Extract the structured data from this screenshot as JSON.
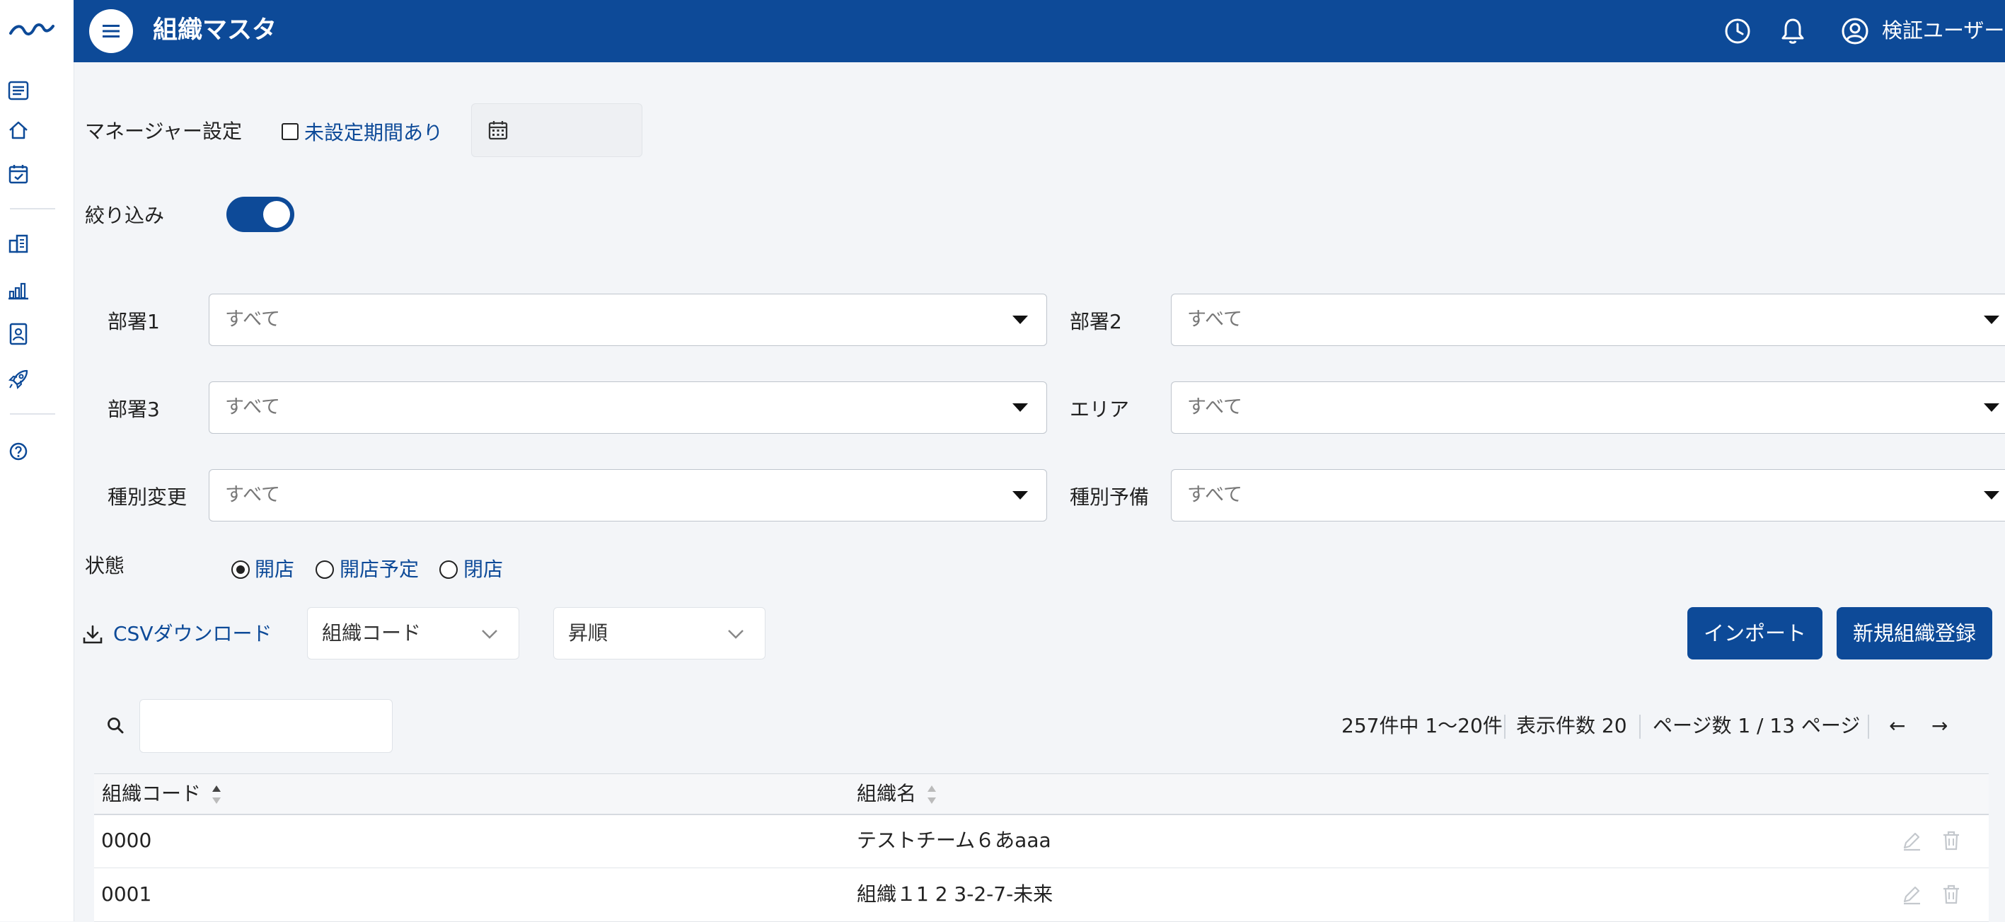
{
  "header": {
    "title": "組織マスタ",
    "user_name": "検証ユーザー"
  },
  "manager": {
    "label": "マネージャー設定",
    "checkbox_label": "未設定期間あり"
  },
  "filter": {
    "toggle_label": "絞り込み",
    "toggle_on": true
  },
  "selects": [
    {
      "label": "部署1",
      "value": "すべて"
    },
    {
      "label": "部署2",
      "value": "すべて"
    },
    {
      "label": "部署3",
      "value": "すべて"
    },
    {
      "label": "エリア",
      "value": "すべて"
    },
    {
      "label": "種別変更",
      "value": "すべて"
    },
    {
      "label": "種別予備",
      "value": "すべて"
    }
  ],
  "status": {
    "label": "状態",
    "options": [
      {
        "label": "開店",
        "selected": true
      },
      {
        "label": "開店予定",
        "selected": false
      },
      {
        "label": "閉店",
        "selected": false
      }
    ]
  },
  "toolbar": {
    "csv_label": "CSVダウンロード",
    "sort_field": "組織コード",
    "sort_order": "昇順",
    "import_label": "インポート",
    "new_label": "新規組織登録"
  },
  "pagination": {
    "summary": "257件中 1〜20件",
    "page_size": "表示件数 20",
    "page_info": "ページ数 1 / 13 ページ",
    "prev": "←",
    "next": "→"
  },
  "table": {
    "columns": [
      "組織コード",
      "組織名"
    ],
    "rows": [
      {
        "code": "0000",
        "name": "テストチーム６あaaa"
      },
      {
        "code": "0001",
        "name": "組織１1 2 3-2-7-未来"
      }
    ]
  },
  "colors": {
    "primary": "#0d4a98",
    "background": "#f3f5f8"
  },
  "icons": {
    "sidebar": [
      "logo-icon",
      "list-icon",
      "home-icon",
      "calendar-check-icon",
      "building-icon",
      "bar-chart-icon",
      "id-badge-icon",
      "rocket-icon",
      "help-icon"
    ],
    "header": [
      "menu-icon",
      "history-icon",
      "bell-icon",
      "user-circle-icon"
    ]
  }
}
